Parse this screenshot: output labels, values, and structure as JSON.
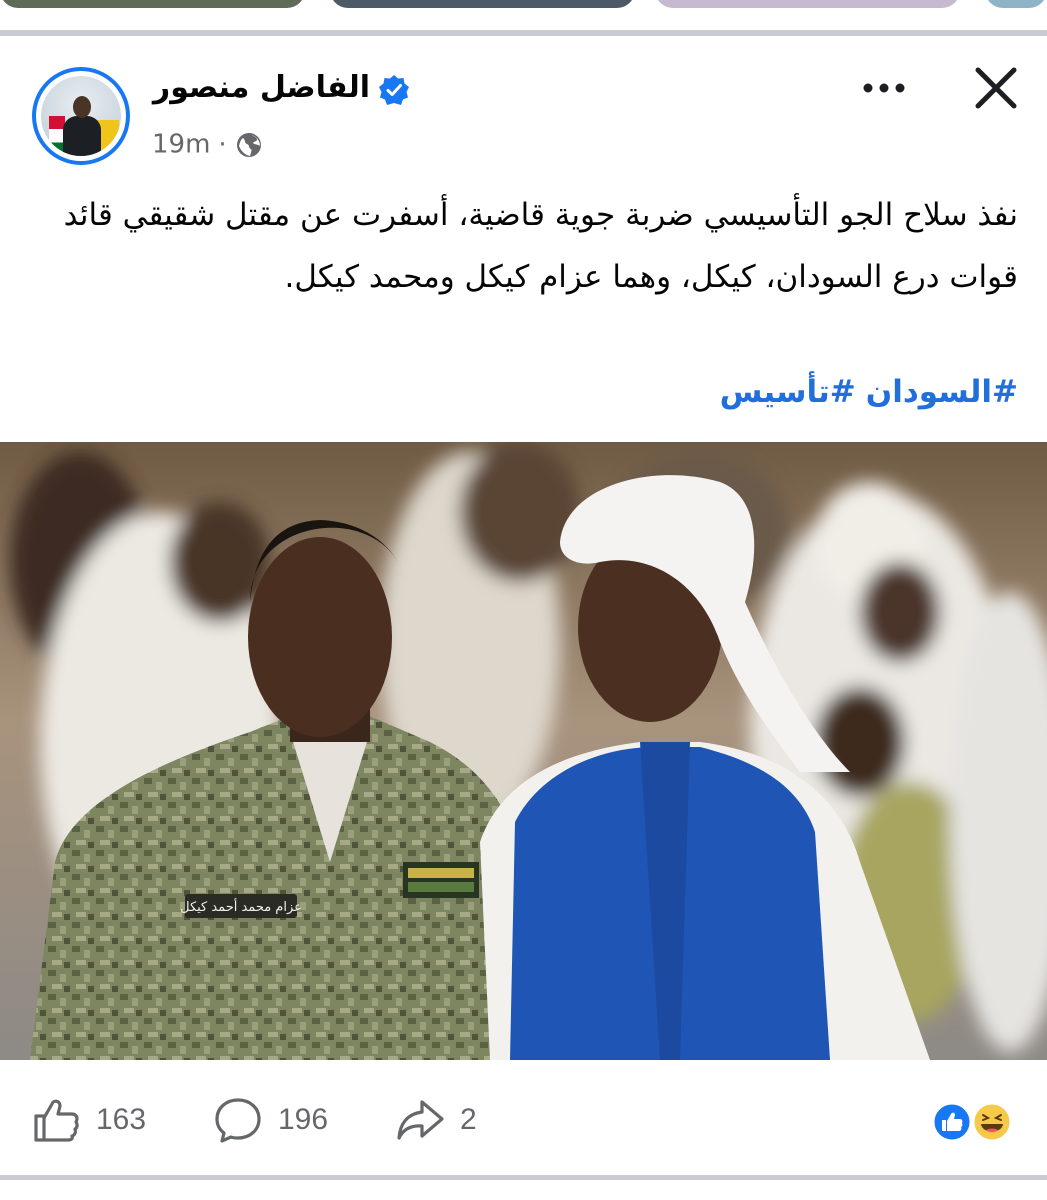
{
  "post": {
    "author_name": "الفاضل منصور",
    "time": "19m",
    "separator": "·",
    "privacy_icon": "globe-icon",
    "verified_icon": "verified-badge-icon",
    "text": "نفذ سلاح الجو التأسيسي ضربة جوية قاضية، أسفرت عن مقتل شقيقي قائد قوات درع السودان، كيكل، وهما عزام كيكل ومحمد كيكل.",
    "hashtags": [
      "#السودان",
      "#تأسيس"
    ],
    "photo_name_tag": "عزام محمد أحمد كيكل"
  },
  "actions": {
    "likes": "163",
    "comments": "196",
    "shares": "2"
  },
  "colors": {
    "brand_blue": "#1877f2",
    "hashtag_blue": "#216fdb",
    "meta_gray": "#65676b",
    "separator_gray": "#c9ccd1"
  }
}
